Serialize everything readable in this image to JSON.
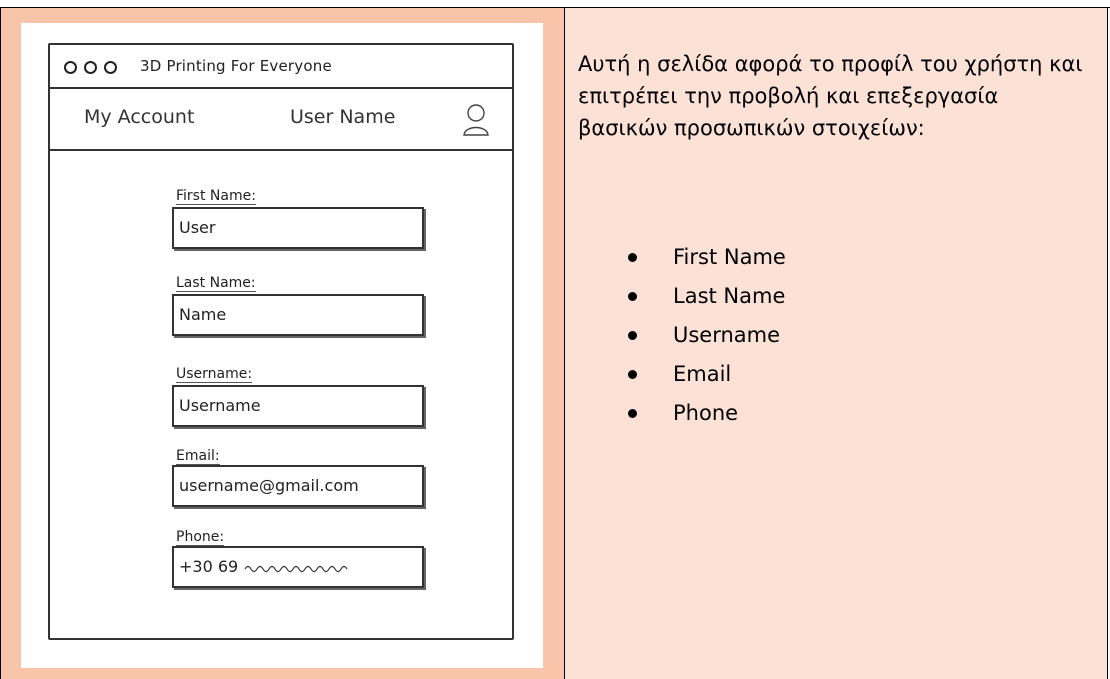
{
  "mockup": {
    "window_title": "3D Printing For Everyone",
    "nav": {
      "account_link": "My Account",
      "user_name": "User Name",
      "avatar_icon": "user-icon"
    },
    "form": {
      "fields": [
        {
          "label": "First Name:",
          "value": "User"
        },
        {
          "label": "Last Name:",
          "value": "Name"
        },
        {
          "label": "Username:",
          "value": "Username"
        },
        {
          "label": "Email:",
          "value": "username@gmail.com"
        },
        {
          "label": "Phone:",
          "value": "+30 69"
        }
      ]
    }
  },
  "description": {
    "text": "Αυτή η σελίδα αφορά το προφίλ του χρήστη και επιτρέπει την προβολή και επεξεργασία βασικών προσωπικών στοιχείων:",
    "items": [
      "First Name",
      "Last Name",
      "Username",
      "Email",
      "Phone"
    ]
  },
  "colors": {
    "left_cell_bg": "#f8c5aa",
    "right_cell_bg": "#fbe1d6",
    "sketch_stroke": "#333333"
  }
}
